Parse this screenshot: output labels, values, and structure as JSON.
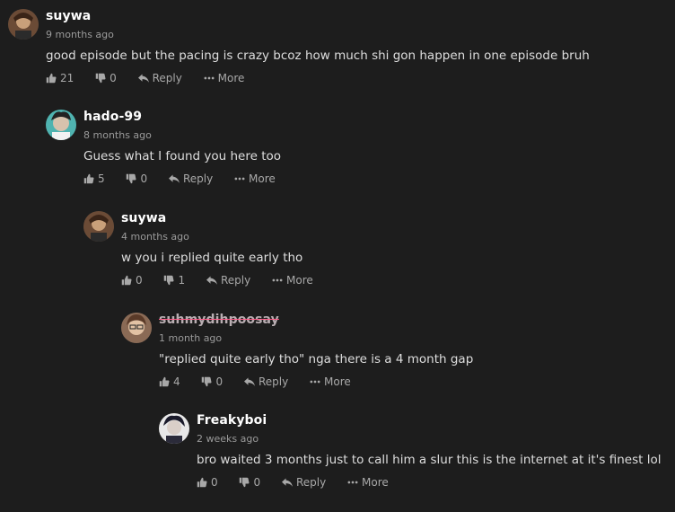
{
  "comments": [
    {
      "username": "suywa",
      "time": "9 months ago",
      "text": "good episode but the pacing is crazy bcoz how much shi gon happen in one episode bruh",
      "likes": "21",
      "dislikes": "0",
      "reply_label": "Reply",
      "more_label": "More"
    },
    {
      "username": "hado-99",
      "time": "8 months ago",
      "text": "Guess what I found you here too",
      "likes": "5",
      "dislikes": "0",
      "reply_label": "Reply",
      "more_label": "More"
    },
    {
      "username": "suywa",
      "time": "4 months ago",
      "text": "w you i replied quite early tho",
      "likes": "0",
      "dislikes": "1",
      "reply_label": "Reply",
      "more_label": "More"
    },
    {
      "username": "suhmydihpoosay",
      "time": "1 month ago",
      "text": "\"replied quite early tho\" nga there is a 4 month gap",
      "likes": "4",
      "dislikes": "0",
      "reply_label": "Reply",
      "more_label": "More"
    },
    {
      "username": "Freakyboi",
      "time": "2 weeks ago",
      "text": "bro waited 3 months just to call him a slur this is the internet at it's finest lol",
      "likes": "0",
      "dislikes": "0",
      "reply_label": "Reply",
      "more_label": "More"
    }
  ],
  "colors": {
    "background": "#1d1d1d",
    "username": "#ffffff",
    "meta": "#9a9a9a",
    "strike": "#ff5a86"
  }
}
